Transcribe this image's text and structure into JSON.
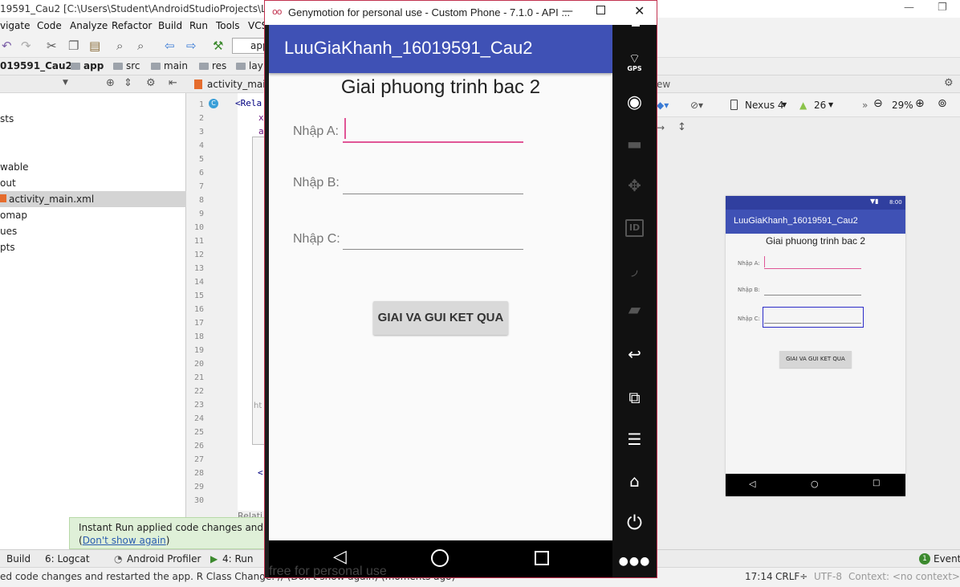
{
  "ide": {
    "window_title": "19591_Cau2 [C:\\Users\\Student\\AndroidStudioProjects\\LuuGiaK",
    "menu": [
      "vigate",
      "Code",
      "Analyze",
      "Refactor",
      "Build",
      "Run",
      "Tools",
      "VCS"
    ],
    "toolbar_app_label": "app",
    "breadcrumb": [
      "019591_Cau2",
      "app",
      "src",
      "main",
      "res",
      "lay"
    ],
    "tree": [
      "sts",
      "wable",
      "out",
      "activity_main.xml",
      "omap",
      "ues",
      "pts"
    ],
    "editor_tab": "activity_main",
    "line_numbers": [
      "1",
      "2",
      "3",
      "4",
      "5",
      "6",
      "7",
      "8",
      "9",
      "10",
      "11",
      "12",
      "13",
      "14",
      "15",
      "16",
      "17",
      "18",
      "19",
      "20",
      "21",
      "22",
      "23",
      "24",
      "25",
      "26",
      "27",
      "28",
      "29",
      "30"
    ],
    "code_line1": "<Rela",
    "code_x": "x",
    "code_a": "a",
    "code_lt": "<",
    "code_ht": "ht",
    "relati_tab": "Relati",
    "instant_run": {
      "line1": "Instant Run applied code changes and resta",
      "paren_open": "(",
      "link": "Don't show again",
      "paren_close": ")"
    },
    "bottom_tabs": {
      "build": "Build",
      "logcat": "6: Logcat",
      "profiler": "Android Profiler",
      "run": "4: Run",
      "event_count": "1",
      "event": "Event"
    },
    "status_message": "ed code changes and restarted the app. R Class Change. // (Don't show again) (moments ago)",
    "status_position": "17:14",
    "status_crlf": "CRLF÷",
    "status_encoding": "UTF-8",
    "status_context": "Context: <no context>",
    "design": {
      "header_label": "ew",
      "device": "Nexus 4",
      "api": "26",
      "zoom": "29%"
    }
  },
  "preview": {
    "status_time": "8:00",
    "app_title": "LuuGiaKhanh_16019591_Cau2",
    "heading": "Giai phuong trinh bac 2",
    "label_a": "Nhập A:",
    "label_b": "Nhập B:",
    "label_c": "Nhập C:",
    "button": "GIAI VA GUI KET QUA"
  },
  "genymotion": {
    "window_title": "Genymotion for personal use - Custom Phone - 7.1.0 - API ...",
    "app_title": "LuuGiaKhanh_16019591_Cau2",
    "heading": "Giai phuong trinh bac 2",
    "label_a": "Nhập A:",
    "label_b": "Nhập B:",
    "label_c": "Nhập C:",
    "button": "GIAI VA GUI KET QUA",
    "gps_label": "GPS",
    "id_label": "ID",
    "watermark": "free for personal use"
  },
  "colors": {
    "app_bar": "#3f51b5",
    "accent_focus": "#e05596",
    "genymotion_border": "#c2324f"
  }
}
